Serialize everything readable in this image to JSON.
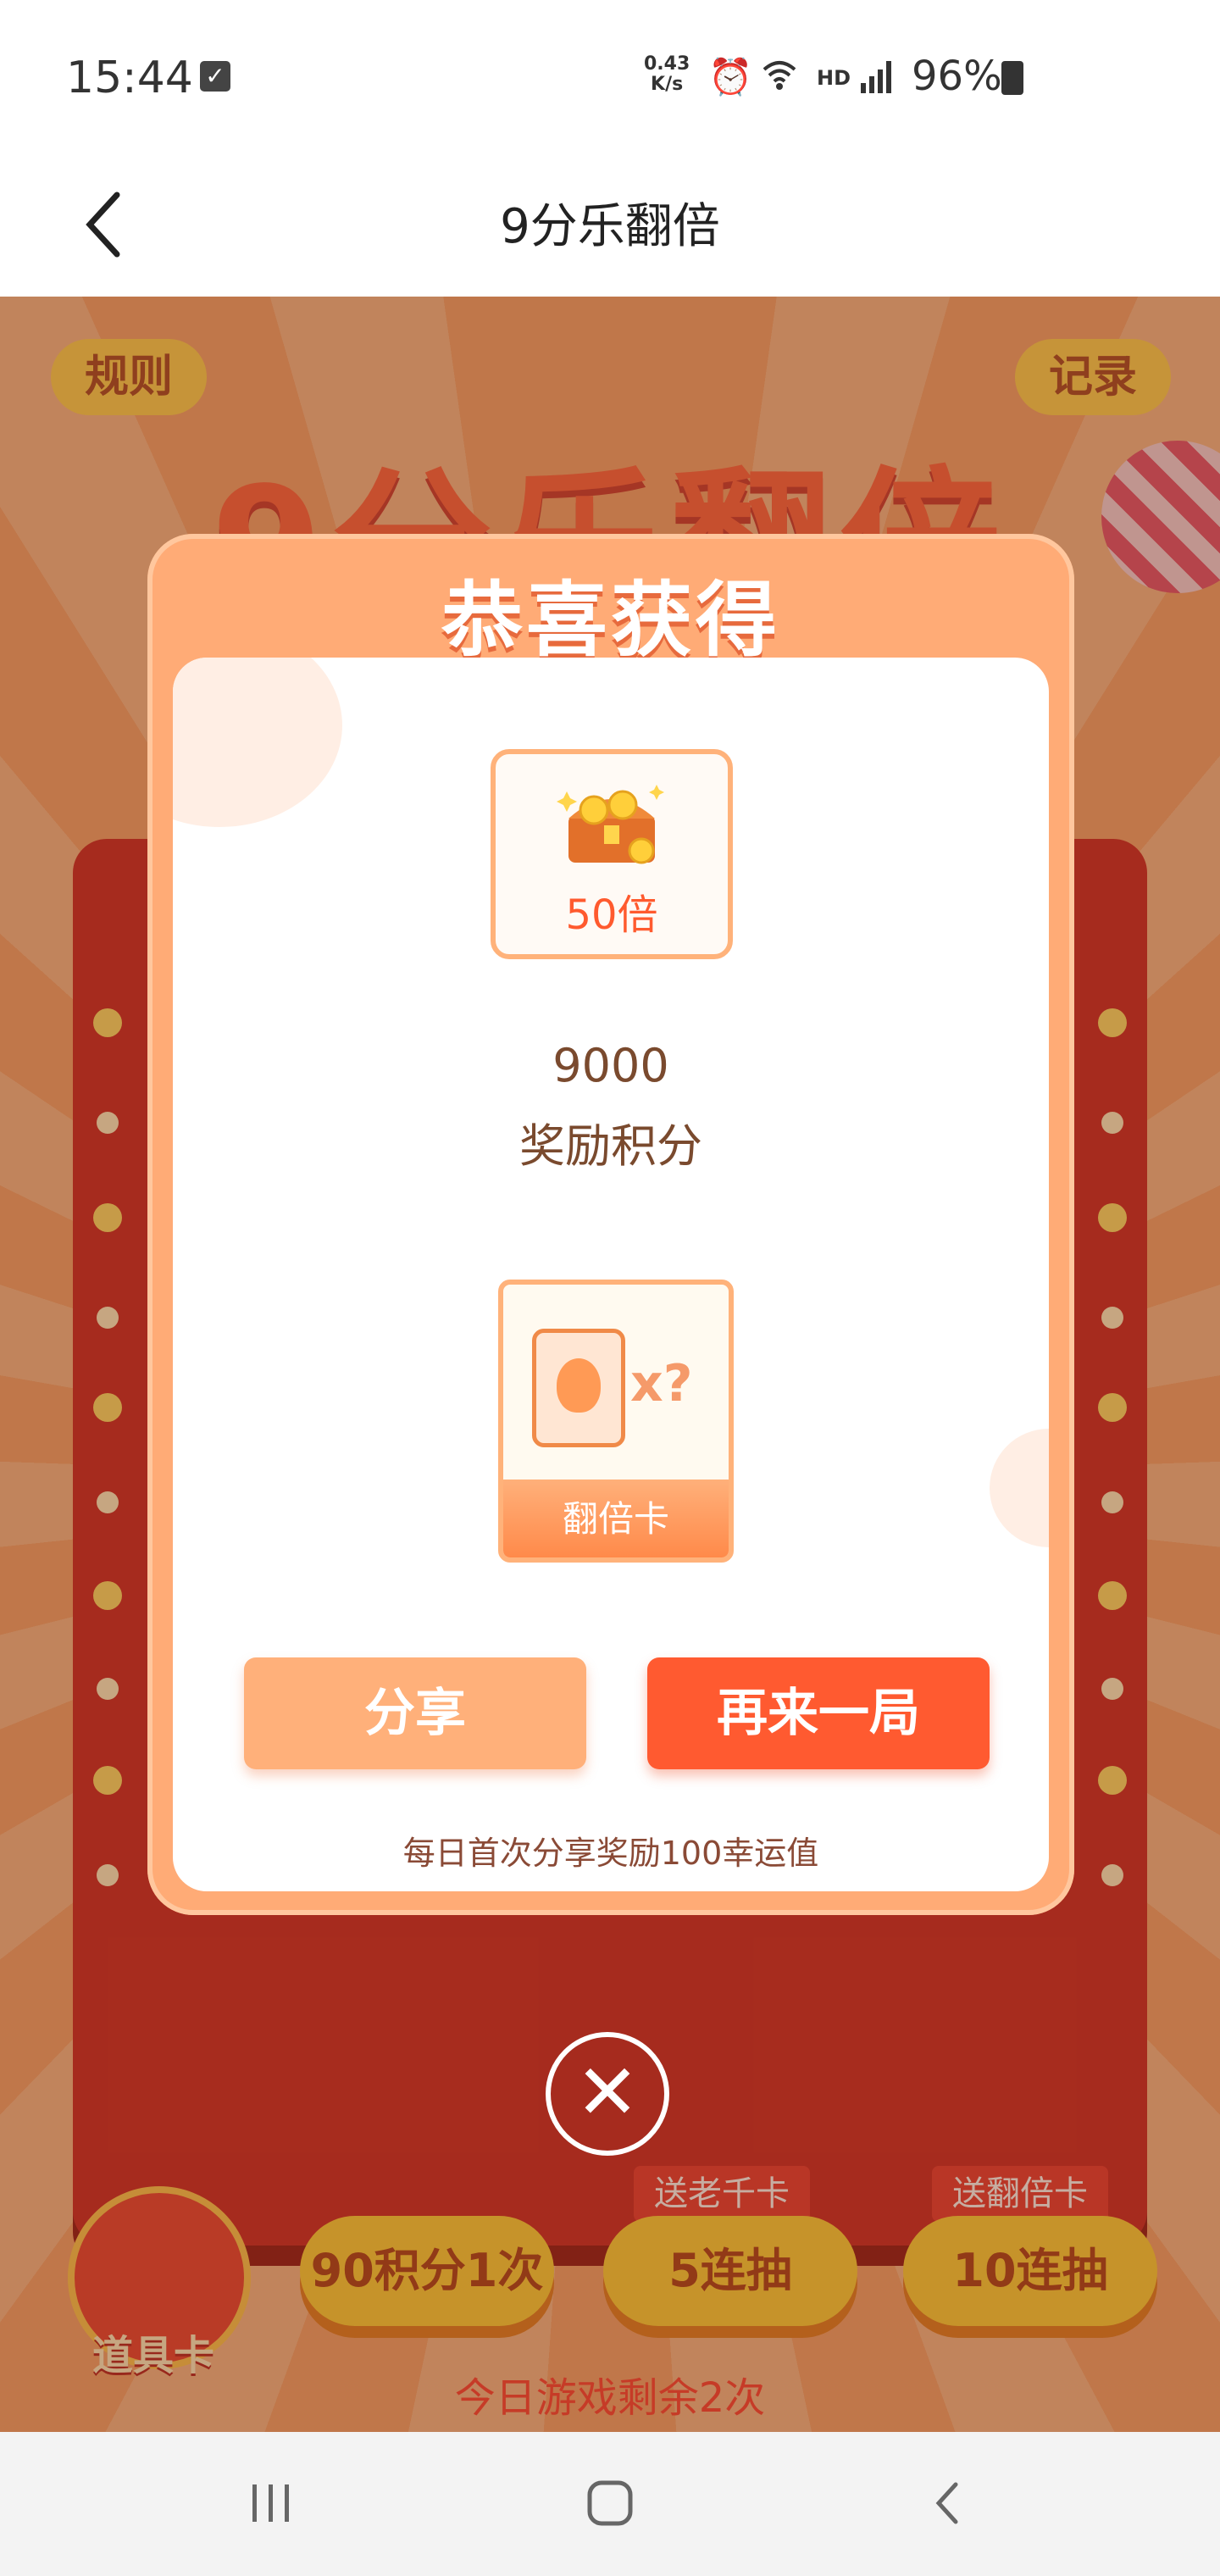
{
  "status_bar": {
    "time": "15:44",
    "speed_value": "0.43",
    "speed_unit": "K/s",
    "network": "HD",
    "battery": "96%",
    "icons": [
      "check-icon",
      "alarm-icon",
      "wifi-icon",
      "signal-icon",
      "battery-icon"
    ]
  },
  "nav": {
    "back_icon": "chevron-left-icon",
    "title": "9分乐翻倍"
  },
  "game": {
    "title": "9分乐翻倍",
    "rules_label": "规则",
    "record_label": "记录",
    "prop_card_label": "道具卡",
    "draw_buttons": [
      {
        "label": "90积分1次",
        "tag": ""
      },
      {
        "label": "5连抽",
        "tag": "送老千卡"
      },
      {
        "label": "10连抽",
        "tag": "送翻倍卡"
      }
    ],
    "remaining_text": "今日游戏剩余2次"
  },
  "modal": {
    "title": "恭喜获得",
    "prize_multiplier": "50倍",
    "reward_value": "9000",
    "reward_label": "奖励积分",
    "card_label": "翻倍卡",
    "card_multiplier": "x?",
    "share_label": "分享",
    "again_label": "再来一局",
    "share_tip": "每日首次分享奖励100幸运值",
    "close_icon": "close-icon"
  },
  "colors": {
    "primary": "#ff5a30",
    "secondary": "#ffb07a",
    "modal_frame": "#ffab76",
    "board": "#c9201e"
  }
}
